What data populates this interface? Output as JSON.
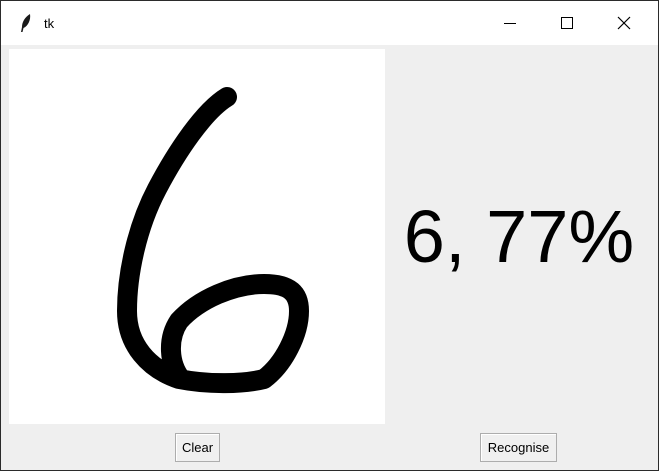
{
  "window": {
    "title": "tk",
    "icons": {
      "app": "tk-feather-icon",
      "minimize": "minimize-icon",
      "maximize": "maximize-icon",
      "close": "close-icon"
    }
  },
  "canvas": {
    "drawing": "handwritten digit 6 in black ink on white canvas",
    "background": "#ffffff",
    "ink_color": "#000000"
  },
  "result": {
    "text": "6, 77%"
  },
  "buttons": {
    "clear_label": "Clear",
    "recognise_label": "Recognise"
  },
  "colors": {
    "window_bg": "#efefef",
    "titlebar_bg": "#ffffff"
  }
}
